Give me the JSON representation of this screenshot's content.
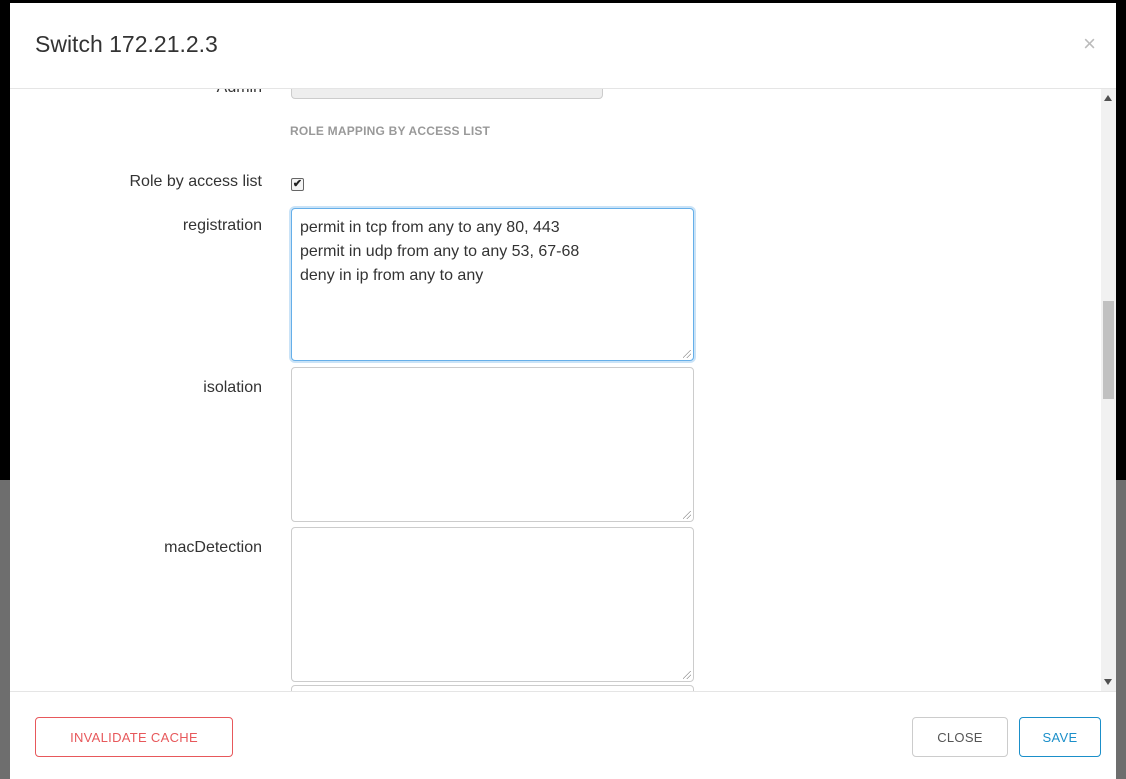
{
  "modal": {
    "title": "Switch 172.21.2.3",
    "close_glyph": "×"
  },
  "body": {
    "partial_label": "Admin",
    "section_heading": "ROLE MAPPING BY ACCESS LIST",
    "role_by_access_list": {
      "label": "Role by access list",
      "checked": true,
      "check_glyph": "✔"
    },
    "fields": [
      {
        "label": "registration",
        "value": "permit in tcp from any to any 80, 443\npermit in udp from any to any 53, 67-68\ndeny in ip from any to any"
      },
      {
        "label": "isolation",
        "value": ""
      },
      {
        "label": "macDetection",
        "value": ""
      }
    ]
  },
  "footer": {
    "invalidate_label": "INVALIDATE CACHE",
    "close_label": "CLOSE",
    "save_label": "SAVE"
  },
  "colors": {
    "danger": "#e7585b",
    "primary": "#1b8fc9",
    "focus": "#66afe9"
  }
}
